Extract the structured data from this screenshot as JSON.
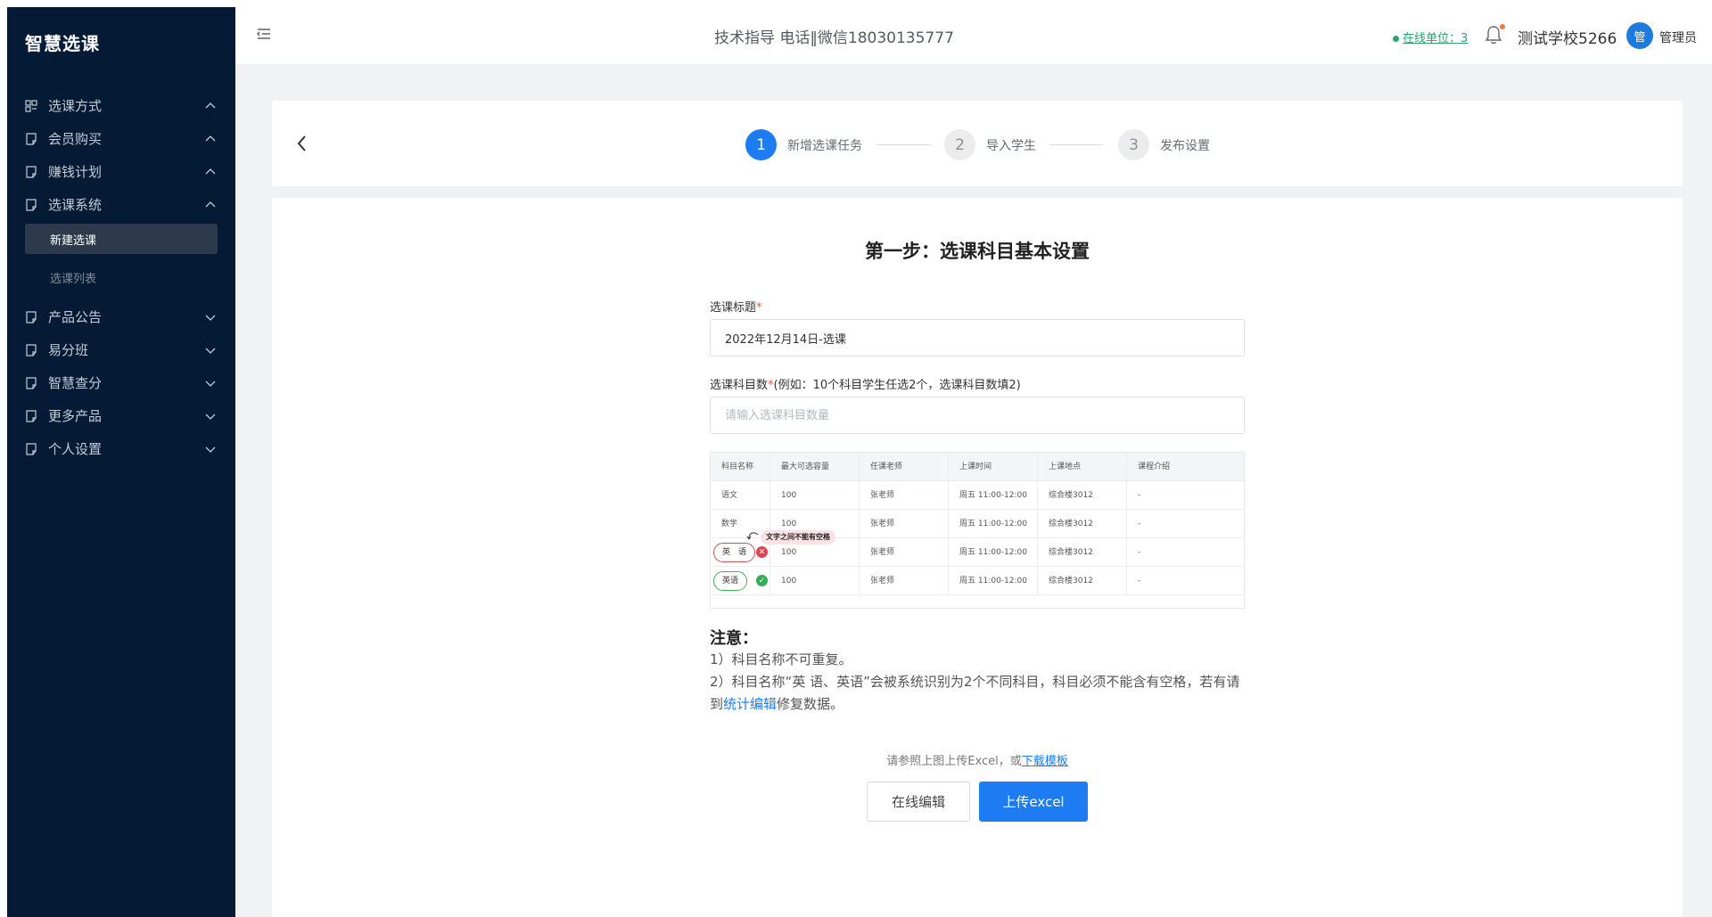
{
  "sidebar": {
    "brand": "智慧选课",
    "items": [
      {
        "label": "选课方式",
        "icon": "grid-icon",
        "expanded": true
      },
      {
        "label": "会员购买",
        "icon": "doc-icon",
        "expanded": true
      },
      {
        "label": "赚钱计划",
        "icon": "doc-icon",
        "expanded": true
      },
      {
        "label": "选课系统",
        "icon": "doc-icon",
        "expanded": true
      },
      {
        "label": "产品公告",
        "icon": "doc-icon",
        "expanded": false
      },
      {
        "label": "易分班",
        "icon": "doc-icon",
        "expanded": false
      },
      {
        "label": "智慧查分",
        "icon": "doc-icon",
        "expanded": false
      },
      {
        "label": "更多产品",
        "icon": "doc-icon",
        "expanded": false
      },
      {
        "label": "个人设置",
        "icon": "doc-icon",
        "expanded": false
      }
    ],
    "subitems": [
      {
        "label": "新建选课",
        "active": true
      },
      {
        "label": "选课列表",
        "active": false
      }
    ]
  },
  "header": {
    "support": "技术指导 电话‖微信18030135777",
    "online": "在线单位：3",
    "school": "测试学校5266",
    "avatar_text": "管",
    "role": "管理员"
  },
  "steps": [
    {
      "num": "1",
      "label": "新增选课任务",
      "active": true
    },
    {
      "num": "2",
      "label": "导入学生",
      "active": false
    },
    {
      "num": "3",
      "label": "发布设置",
      "active": false
    }
  ],
  "form": {
    "page_title": "第一步：选课科目基本设置",
    "title_label": "选课标题",
    "title_required": "*",
    "title_value": "2022年12月14日-选课",
    "count_label": "选课科目数",
    "count_required": "*",
    "count_hint": "(例如：10个科目学生任选2个，选课科目数填2)",
    "count_placeholder": "请输入选课科目数量"
  },
  "example": {
    "headers": [
      "科目名称",
      "最大可选容量",
      "任课老师",
      "上课时间",
      "上课地点",
      "课程介绍"
    ],
    "rows": [
      [
        "语文",
        "100",
        "张老师",
        "周五 11:00-12:00",
        "综合楼3012",
        "-"
      ],
      [
        "数学",
        "100",
        "张老师",
        "周五 11:00-12:00",
        "综合楼3012",
        "-"
      ],
      [
        "英　语",
        "100",
        "张老师",
        "周五 11:00-12:00",
        "综合楼3012",
        "-"
      ],
      [
        "英语",
        "100",
        "张老师",
        "周五 11:00-12:00",
        "综合楼3012",
        "-"
      ]
    ],
    "error_tip": "文字之间不能有空格"
  },
  "notes": {
    "title": "注意：",
    "line1": "1）科目名称不可重复。",
    "line2_pre": "2）科目名称“英 语、英语”会被系统识别为2个不同科目，科目必须不能含有空格，若有请到",
    "line2_link": "统计编辑",
    "line2_post": "修复数据。"
  },
  "upload": {
    "hint": "请参照上图上传Excel，或",
    "download": "下载模板",
    "online_edit": "在线编辑",
    "upload_excel": "上传excel"
  },
  "colors": {
    "sidebar": "#051a34",
    "primary": "#1e7cf2",
    "online_green": "#2aa36b",
    "error_red": "#e0424f",
    "ok_green": "#37ad55"
  }
}
